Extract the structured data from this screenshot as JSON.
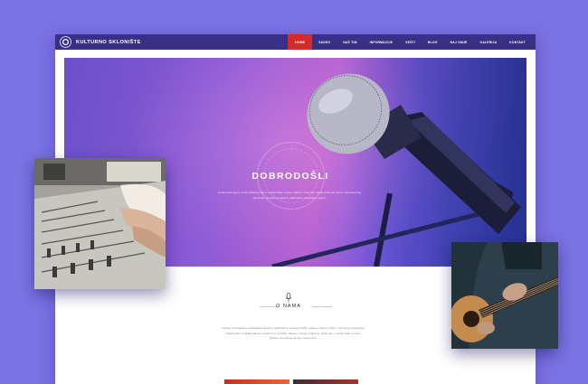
{
  "header": {
    "brand": "KULTURNO SKLONIŠTE",
    "nav": [
      {
        "label": "HOME",
        "active": true
      },
      {
        "label": "SADEO",
        "active": false
      },
      {
        "label": "NAŠ TIM",
        "active": false
      },
      {
        "label": "INFORMACIJE",
        "active": false
      },
      {
        "label": "VESTI",
        "active": false
      },
      {
        "label": "BLOG",
        "active": false
      },
      {
        "label": "NAJ OMJE",
        "active": false
      },
      {
        "label": "GALERIJA",
        "active": false
      },
      {
        "label": "KONTAKT",
        "active": false
      }
    ]
  },
  "hero": {
    "title": "DOBRODOŠLI",
    "text": "Kratki tekst koji se ovde prikazuje nije u celosti čitljiv u ovom prikazu. Ovaj deo teksta služi kao uvod u rad kulturnog skloništa i njegove programe, aktivnosti i događaje u gradu."
  },
  "about": {
    "title": "O NAMA",
    "text": "Centar za mladinsko stvaralaštvo kulturno skloniste je osnovan 2008. godine u Novom Sadu. Cilj nam je okupljanje mladih ljudi i podrška njihovom radu kroz muzičke, likovne i druge programe. Tekst nije u celosti čitljiv u ovom prikazu, ali opisuje istoriju i rad centra."
  },
  "colors": {
    "background": "#7b73e4",
    "topbar": "#3a2f86",
    "active_nav": "#d22b2b"
  },
  "icons": [
    "logo-icon",
    "microphone-icon"
  ]
}
